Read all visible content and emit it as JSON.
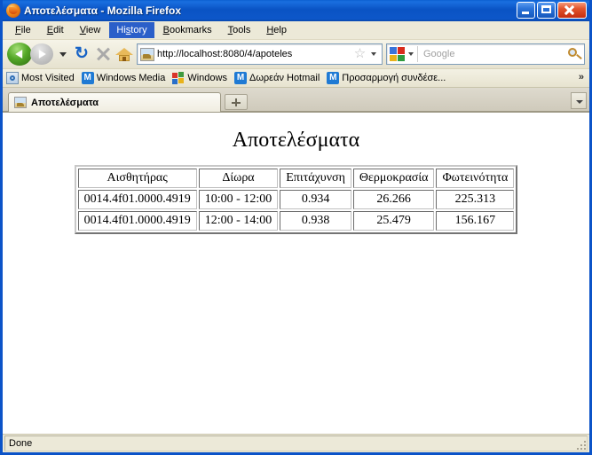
{
  "window": {
    "title": "Αποτελέσματα - Mozilla Firefox",
    "icon": "firefox-icon",
    "minimize_label": "Minimize",
    "maximize_label": "Maximize",
    "close_label": "Close"
  },
  "menubar": {
    "items": [
      {
        "label": "File",
        "accel": "F",
        "active": false
      },
      {
        "label": "Edit",
        "accel": "E",
        "active": false
      },
      {
        "label": "View",
        "accel": "V",
        "active": false
      },
      {
        "label": "History",
        "accel": "s",
        "active": true
      },
      {
        "label": "Bookmarks",
        "accel": "B",
        "active": false
      },
      {
        "label": "Tools",
        "accel": "T",
        "active": false
      },
      {
        "label": "Help",
        "accel": "H",
        "active": false
      }
    ]
  },
  "toolbar": {
    "back_label": "Back",
    "forward_label": "Forward",
    "reload_glyph": "↻",
    "reload_label": "Reload",
    "stop_label": "Stop",
    "home_label": "Home",
    "url": "http://localhost:8080/4/apoteles",
    "url_star_glyph": "☆",
    "search_placeholder": "Google",
    "search_value": ""
  },
  "bookmarks": {
    "items": [
      {
        "label": "Most Visited",
        "icon": "most-visited-icon"
      },
      {
        "label": "Windows Media",
        "icon": "msn-icon",
        "badge": "M"
      },
      {
        "label": "Windows",
        "icon": "windows-logo-icon"
      },
      {
        "label": "Δωρεάν Hotmail",
        "icon": "msn-icon",
        "badge": "M"
      },
      {
        "label": "Προσαρμογή συνδέσε...",
        "icon": "msn-icon",
        "badge": "M"
      }
    ],
    "overflow_glyph": "»"
  },
  "tabs": {
    "items": [
      {
        "label": "Αποτελέσματα",
        "icon": "page-favicon",
        "active": true
      }
    ],
    "new_tab_label": "New Tab",
    "tab_list_label": "List all tabs"
  },
  "page": {
    "heading": "Αποτελέσματα",
    "table": {
      "headers": [
        "Αισθητήρας",
        "Δίωρα",
        "Επιτάχυνση",
        "Θερμοκρασία",
        "Φωτεινότητα"
      ],
      "rows": [
        [
          "0014.4f01.0000.4919",
          "10:00 - 12:00",
          "0.934",
          "26.266",
          "225.313"
        ],
        [
          "0014.4f01.0000.4919",
          "12:00 - 14:00",
          "0.938",
          "25.479",
          "156.167"
        ]
      ]
    }
  },
  "statusbar": {
    "text": "Done"
  },
  "colors": {
    "titlebar_blue": "#0a53c4",
    "window_border": "#0b53c8",
    "chrome_beige": "#ece9d8",
    "menu_highlight": "#2b5fc9",
    "close_red": "#c42d10",
    "back_green": "#54a828"
  }
}
